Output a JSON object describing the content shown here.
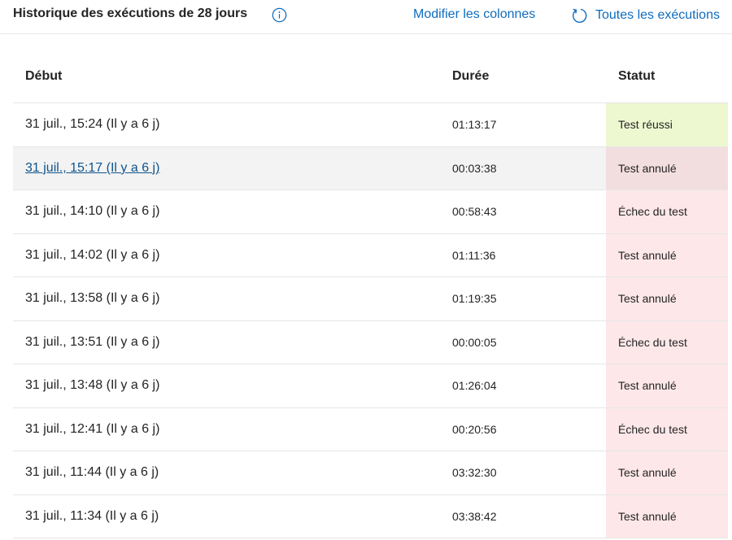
{
  "header": {
    "title": "Historique des exécutions de 28 jours",
    "info_icon": "info-icon",
    "edit_columns_label": "Modifier les colonnes",
    "all_runs_label": "Toutes les exécutions",
    "refresh_icon": "refresh-icon",
    "link_color": "#0f6cbd"
  },
  "table": {
    "columns": [
      "Début",
      "Durée",
      "Statut"
    ],
    "status_colors": {
      "success": "#eef8d0",
      "cancelled": "#fde7e9",
      "cancelled_selected": "#f3dedf",
      "failed": "#fde7e9"
    },
    "rows": [
      {
        "start": "31 juil., 15:24 (Il y a 6 j)",
        "duration": "01:13:17",
        "status": "Test réussi",
        "status_kind": "success"
      },
      {
        "start": "31 juil., 15:17 (Il y a 6 j)",
        "duration": "00:03:38",
        "status": "Test annulé",
        "status_kind": "cancelled",
        "selected": true
      },
      {
        "start": "31 juil., 14:10 (Il y a 6 j)",
        "duration": "00:58:43",
        "status": "Échec du test",
        "status_kind": "failed"
      },
      {
        "start": "31 juil., 14:02 (Il y a 6 j)",
        "duration": "01:11:36",
        "status": "Test annulé",
        "status_kind": "cancelled"
      },
      {
        "start": "31 juil., 13:58 (Il y a 6 j)",
        "duration": "01:19:35",
        "status": "Test annulé",
        "status_kind": "cancelled"
      },
      {
        "start": "31 juil., 13:51 (Il y a 6 j)",
        "duration": "00:00:05",
        "status": "Échec du test",
        "status_kind": "failed"
      },
      {
        "start": "31 juil., 13:48 (Il y a 6 j)",
        "duration": "01:26:04",
        "status": "Test annulé",
        "status_kind": "cancelled"
      },
      {
        "start": "31 juil., 12:41 (Il y a 6 j)",
        "duration": "00:20:56",
        "status": "Échec du test",
        "status_kind": "failed"
      },
      {
        "start": "31 juil., 11:44 (Il y a 6 j)",
        "duration": "03:32:30",
        "status": "Test annulé",
        "status_kind": "cancelled"
      },
      {
        "start": "31 juil., 11:34 (Il y a 6 j)",
        "duration": "03:38:42",
        "status": "Test annulé",
        "status_kind": "cancelled"
      }
    ]
  }
}
